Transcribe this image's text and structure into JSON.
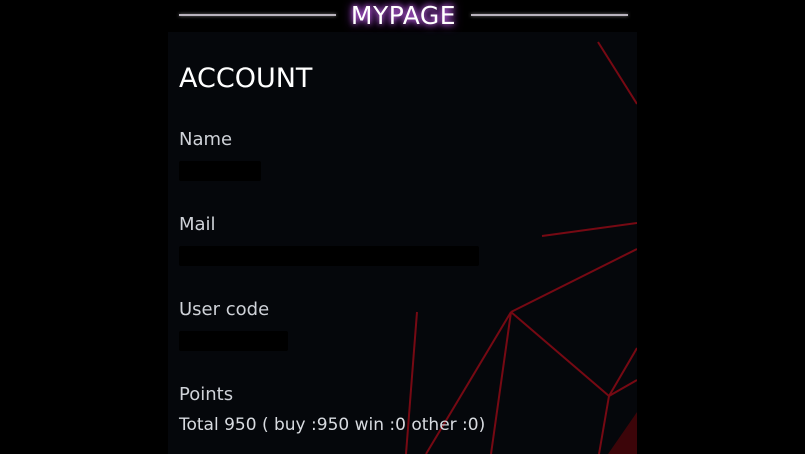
{
  "header": {
    "title": "MYPAGE"
  },
  "account": {
    "title": "ACCOUNT",
    "fields": [
      {
        "label": "Name"
      },
      {
        "label": "Mail"
      },
      {
        "label": "User code"
      },
      {
        "label": "Points",
        "value": "Total 950 ( buy :950 win :0 other :0)"
      }
    ]
  },
  "colors": {
    "background": "#05070b",
    "outer_background": "#000000",
    "title_glow": "#d36bff",
    "decor_lines": "#8a0d16"
  }
}
